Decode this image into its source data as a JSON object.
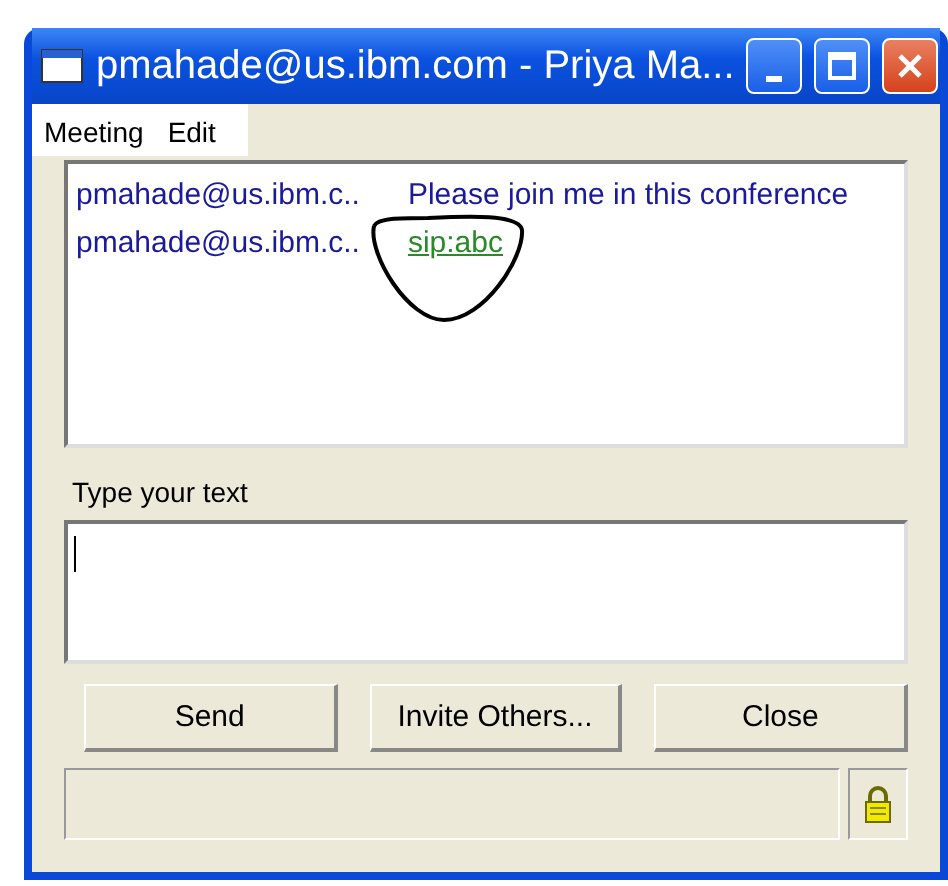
{
  "window": {
    "title": "pmahade@us.ibm.com - Priya Ma..."
  },
  "menu": [
    "Meeting",
    "Edit"
  ],
  "messages": [
    {
      "sender": "pmahade@us.ibm.c..",
      "text": "Please join me in this conference",
      "kind": "text"
    },
    {
      "sender": "pmahade@us.ibm.c..",
      "text": "sip:abc",
      "kind": "link"
    }
  ],
  "compose": {
    "label": "Type your text"
  },
  "buttons": [
    "Send",
    "Invite Others...",
    "Close"
  ],
  "status_bar": {
    "locked": true
  }
}
